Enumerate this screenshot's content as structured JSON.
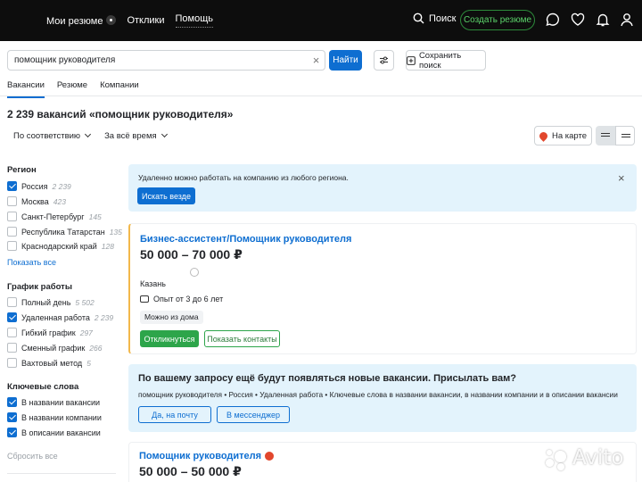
{
  "header": {
    "nav": [
      "Мои резюме",
      "Отклики",
      "Помощь"
    ],
    "search_label": "Поиск",
    "create_resume": "Создать резюме"
  },
  "search": {
    "value": "помощник руководителя",
    "find_button": "Найти",
    "save_search": "Сохранить поиск"
  },
  "tabs": [
    "Вакансии",
    "Резюме",
    "Компании"
  ],
  "results": {
    "title": "2 239 вакансий «помощник руководителя»",
    "sort": "По соответствию",
    "period": "За всё время",
    "map_button": "На карте"
  },
  "sidebar": {
    "region": {
      "title": "Регион",
      "items": [
        {
          "label": "Россия",
          "count": "2 239",
          "checked": true
        },
        {
          "label": "Москва",
          "count": "423",
          "checked": false
        },
        {
          "label": "Санкт-Петербург",
          "count": "145",
          "checked": false
        },
        {
          "label": "Республика Татарстан",
          "count": "135",
          "checked": false
        },
        {
          "label": "Краснодарский край",
          "count": "128",
          "checked": false
        }
      ],
      "show_all": "Показать все"
    },
    "schedule": {
      "title": "График работы",
      "items": [
        {
          "label": "Полный день",
          "count": "5 502",
          "checked": false
        },
        {
          "label": "Удаленная работа",
          "count": "2 239",
          "checked": true
        },
        {
          "label": "Гибкий график",
          "count": "297",
          "checked": false
        },
        {
          "label": "Сменный график",
          "count": "266",
          "checked": false
        },
        {
          "label": "Вахтовый метод",
          "count": "5",
          "checked": false
        }
      ]
    },
    "keywords": {
      "title": "Ключевые слова",
      "items": [
        {
          "label": "В названии вакансии",
          "checked": true
        },
        {
          "label": "В названии компании",
          "checked": true
        },
        {
          "label": "В описании вакансии",
          "checked": true
        }
      ],
      "reset": "Сбросить все"
    }
  },
  "banner": {
    "text": "Удаленно можно работать на компанию из любого региона.",
    "button": "Искать везде"
  },
  "vacancy1": {
    "title": "Бизнес-ассистент/Помощник руководителя",
    "salary": "50 000 – 70 000 ₽",
    "city": "Казань",
    "experience": "Опыт от 3 до 6 лет",
    "tag": "Можно из дома",
    "respond": "Откликнуться",
    "contacts": "Показать контакты"
  },
  "subscribe": {
    "title": "По вашему запросу ещё будут появляться новые вакансии. Присылать вам?",
    "query": "помощник руководителя • Россия • Удаленная работа • Ключевые слова в названии вакансии, в названии компании и в описании вакансии",
    "email_button": "Да, на почту",
    "messenger_button": "В мессенджер"
  },
  "vacancy2": {
    "title": "Помощник руководителя",
    "salary": "50 000 – 50 000 ₽"
  },
  "watermark": "Avito",
  "colors": {
    "accent": "#0e6ed1",
    "green": "#2da54a",
    "banner": "#e3f3fc"
  }
}
